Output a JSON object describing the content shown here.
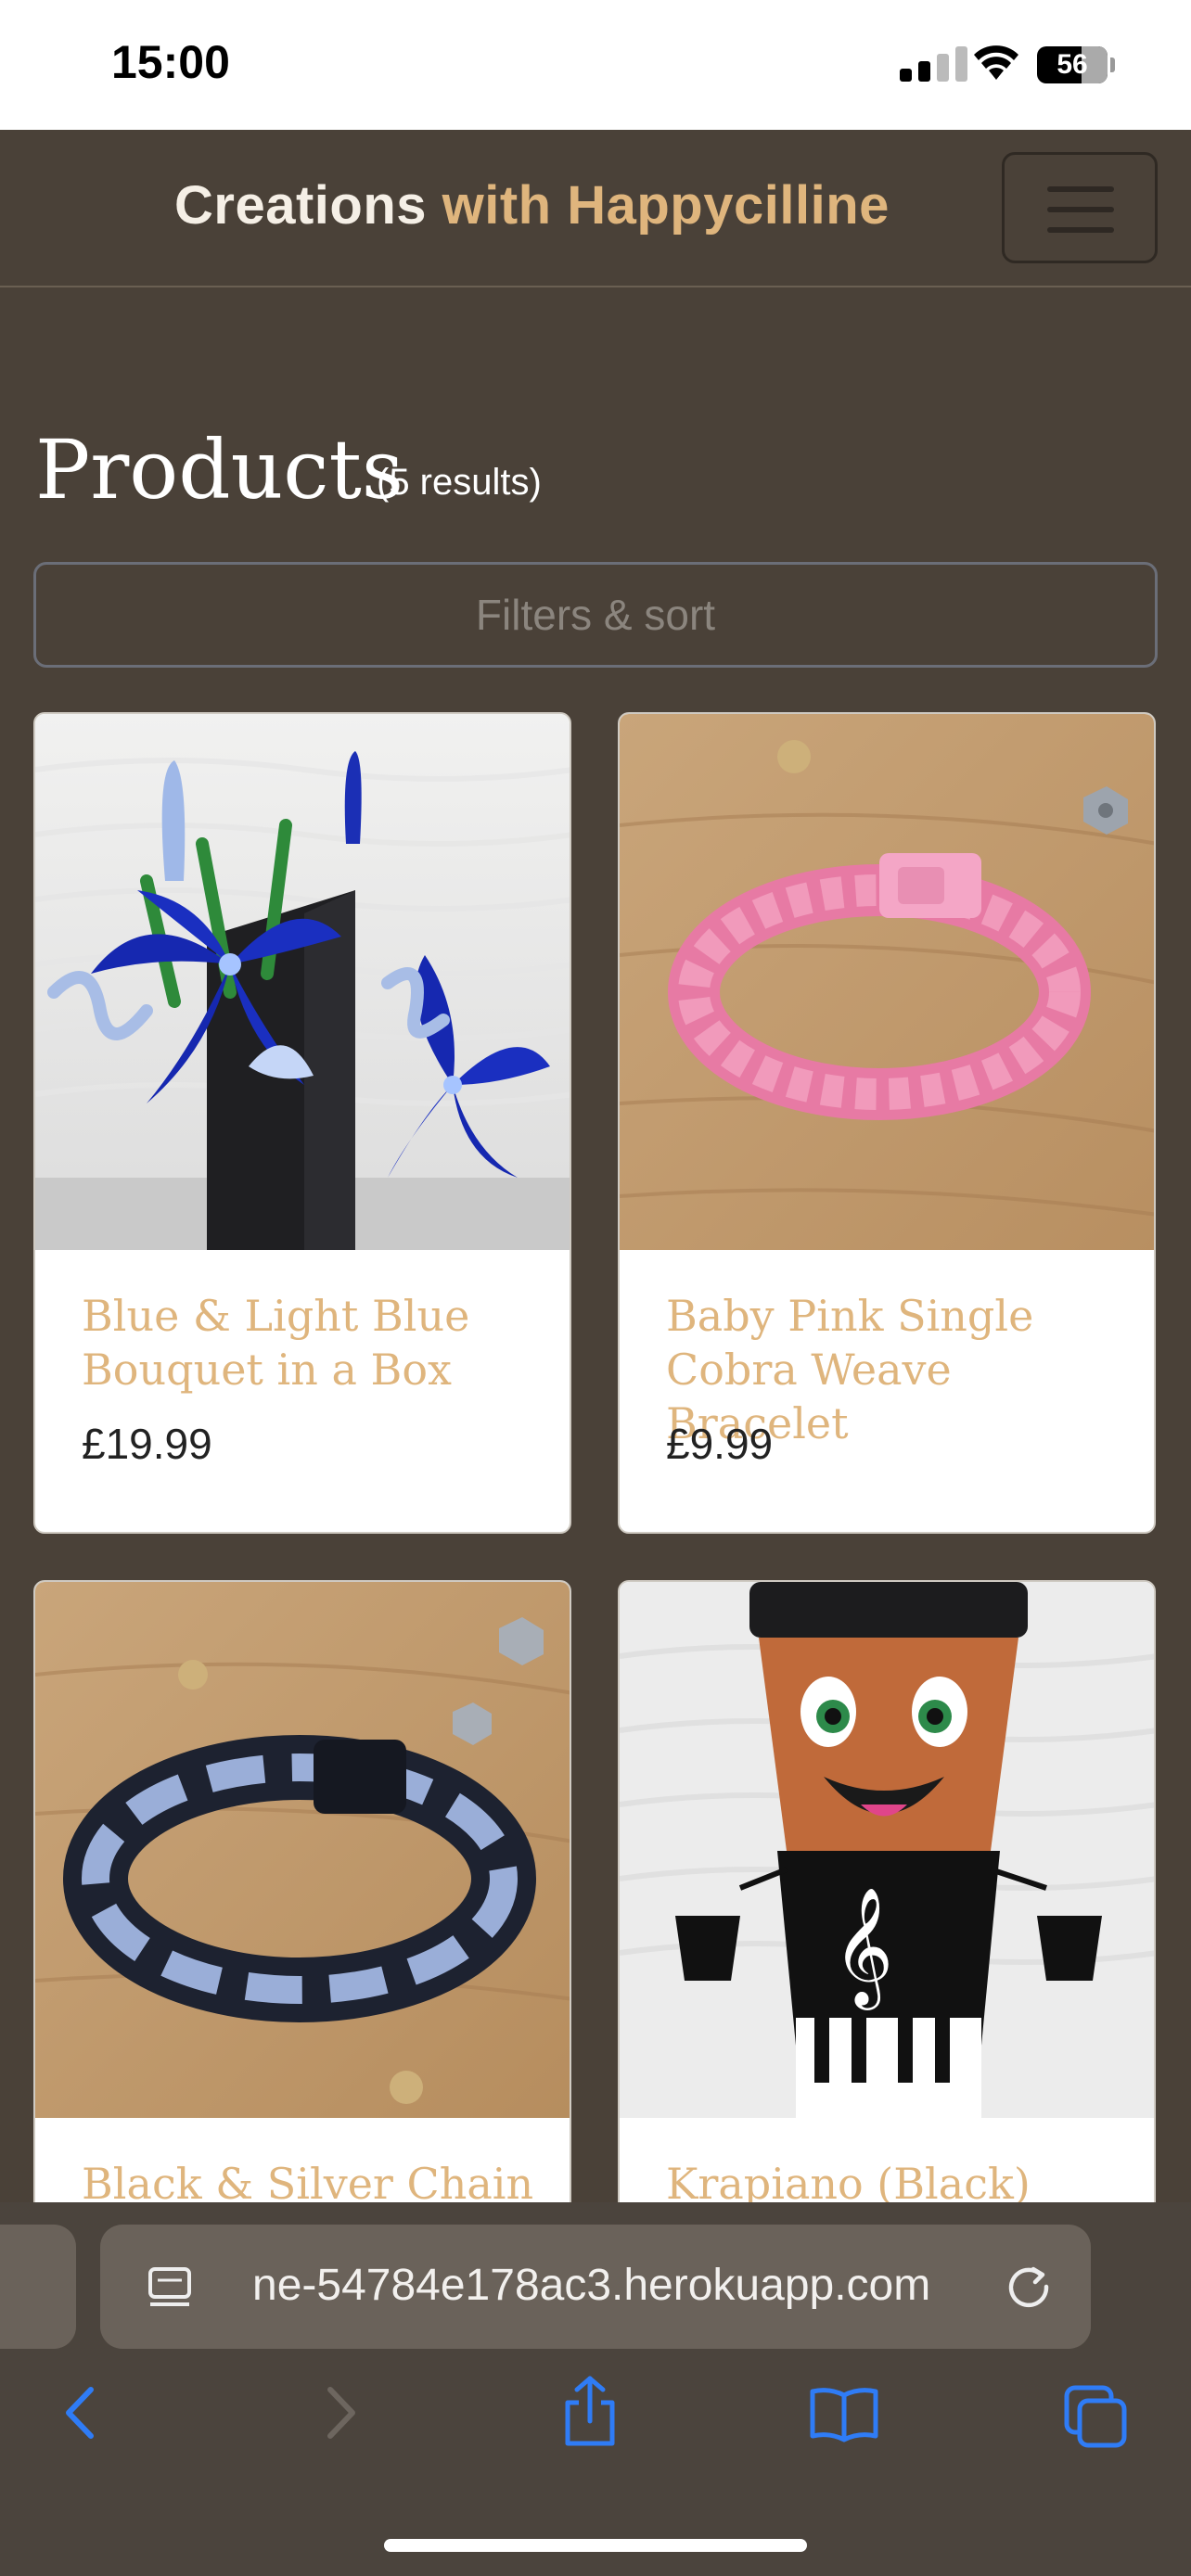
{
  "status_bar": {
    "time": "15:00",
    "battery": "56"
  },
  "navbar": {
    "brand_part1": "Creations",
    "brand_part2": "with Happycilline"
  },
  "main": {
    "heading": "Products",
    "results": "(5 results)",
    "filters_label": "Filters & sort"
  },
  "products": [
    {
      "title": "Blue & Light Blue Bouquet in a Box",
      "price": "£19.99"
    },
    {
      "title": "Baby Pink Single Cobra Weave Bracelet",
      "price": "£9.99"
    },
    {
      "title": "Black & Silver Chain",
      "price": ""
    },
    {
      "title": "Krapiano (Black)",
      "price": ""
    }
  ],
  "browser": {
    "url": "ne-54784e178ac3.herokuapp.com"
  },
  "colors": {
    "accent": "#dfb57d",
    "background": "#4a4138",
    "link_blue": "#2f7cf6"
  }
}
